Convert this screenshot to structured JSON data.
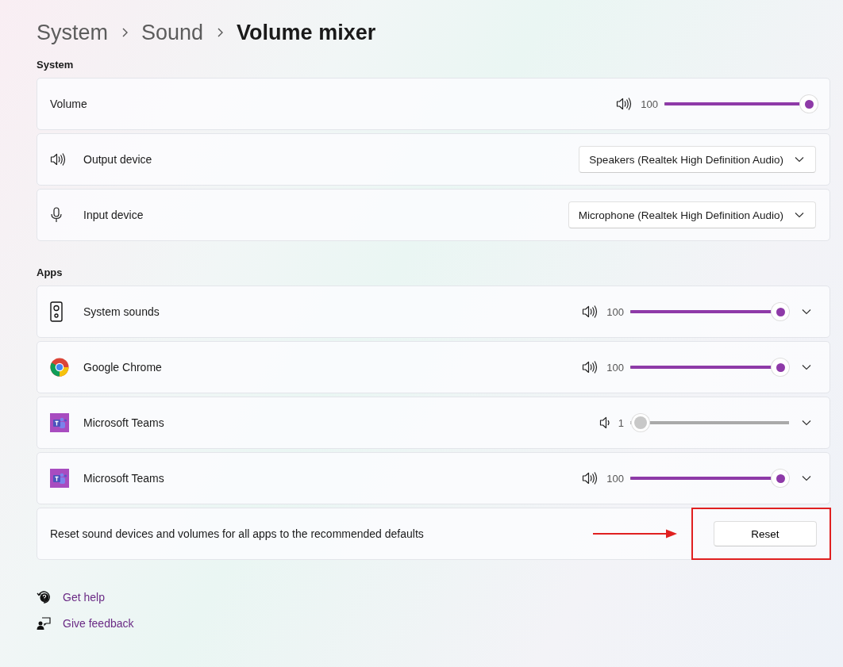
{
  "breadcrumb": [
    "System",
    "Sound",
    "Volume mixer"
  ],
  "system": {
    "heading": "System",
    "volume": {
      "label": "Volume",
      "reading": "100",
      "level": 1.0,
      "muted": false
    },
    "devices": [
      {
        "kind": "output",
        "label": "Output device",
        "value": "Speakers (Realtek High Definition Audio)"
      },
      {
        "kind": "input",
        "label": "Input device",
        "value": "Microphone (Realtek High Definition Audio)"
      }
    ]
  },
  "apps": {
    "heading": "Apps",
    "items": [
      {
        "kind": "speaker-box",
        "name": "System sounds",
        "reading": "100",
        "level": 1.0,
        "muted": false
      },
      {
        "kind": "chrome",
        "name": "Google Chrome",
        "reading": "100",
        "level": 1.0,
        "muted": false
      },
      {
        "kind": "teams",
        "name": "Microsoft Teams",
        "reading": "1",
        "level": 0.01,
        "muted": true
      },
      {
        "kind": "teams",
        "name": "Microsoft Teams",
        "reading": "100",
        "level": 1.0,
        "muted": false
      }
    ]
  },
  "reset": {
    "text": "Reset sound devices and volumes for all apps to the recommended defaults",
    "button": "Reset",
    "highlighted": true
  },
  "links": [
    {
      "kind": "help",
      "label": "Get help"
    },
    {
      "kind": "feedback",
      "label": "Give feedback"
    }
  ]
}
